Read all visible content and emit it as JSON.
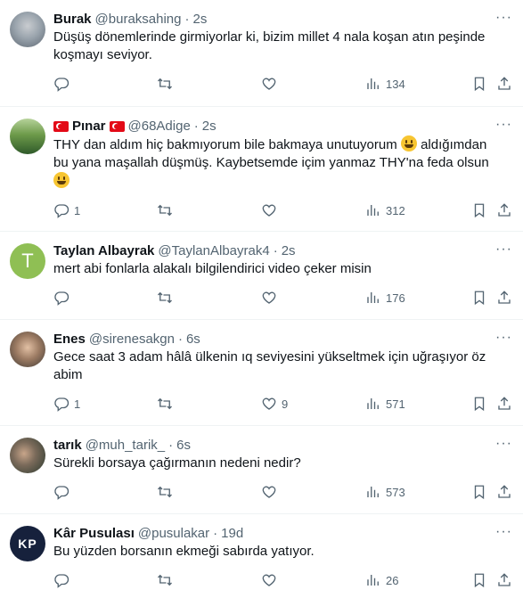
{
  "tweets": [
    {
      "avatar": "burak-avatar",
      "name": "Burak",
      "flags": false,
      "handle": "@buraksahing",
      "time": "2s",
      "text_parts": [
        "Düşüş dönemlerinde girmiyorlar ki, bizim millet 4 nala koşan atın peşinde koşmayı seviyor."
      ],
      "replies": "",
      "retweets": "",
      "likes": "",
      "views": "134"
    },
    {
      "avatar": "pinar-avatar",
      "name": "Pınar",
      "flags": true,
      "handle": "@68Adige",
      "time": "2s",
      "text_parts": [
        "THY dan aldım hiç bakmıyorum bile bakmaya unutuyorum ",
        " aldığımdan bu yana maşallah düşmüş. Kaybetsemde içim yanmaz THY'na feda olsun ",
        ""
      ],
      "replies": "1",
      "retweets": "",
      "likes": "",
      "views": "312"
    },
    {
      "avatar": "T",
      "name": "Taylan Albayrak",
      "flags": false,
      "handle": "@TaylanAlbayrak4",
      "time": "2s",
      "text_parts": [
        "mert abi fonlarla alakalı bilgilendirici video çeker misin"
      ],
      "replies": "",
      "retweets": "",
      "likes": "",
      "views": "176"
    },
    {
      "avatar": "enes-avatar",
      "name": "Enes",
      "flags": false,
      "handle": "@sirenesakgn",
      "time": "6s",
      "text_parts": [
        "Gece saat 3 adam hâlâ ülkenin ıq seviyesini yükseltmek için uğraşıyor öz abim"
      ],
      "replies": "1",
      "retweets": "",
      "likes": "9",
      "views": "571"
    },
    {
      "avatar": "tarik-avatar",
      "name": "tarık",
      "flags": false,
      "handle": "@muh_tarik_",
      "time": "6s",
      "text_parts": [
        "Sürekli borsaya çağırmanın nedeni nedir?"
      ],
      "replies": "",
      "retweets": "",
      "likes": "",
      "views": "573"
    },
    {
      "avatar": "KP",
      "name": "Kâr Pusulası",
      "flags": false,
      "handle": "@pusulakar",
      "time": "19d",
      "text_parts": [
        "Bu yüzden borsanın ekmeği sabırda yatıyor."
      ],
      "replies": "",
      "retweets": "",
      "likes": "",
      "views": "26"
    }
  ],
  "ui": {
    "separator": "·",
    "more": "···"
  }
}
